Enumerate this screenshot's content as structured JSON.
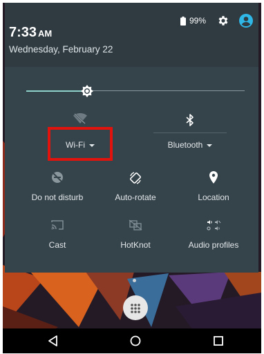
{
  "status": {
    "time": "7:33",
    "ampm": "AM",
    "date": "Wednesday, February 22",
    "battery": "99%"
  },
  "brightness": {
    "level": 0.28
  },
  "tiles": {
    "wifi": {
      "label": "Wi-Fi",
      "icon": "wifi-off-icon",
      "has_dropdown": true
    },
    "bluetooth": {
      "label": "Bluetooth",
      "icon": "bluetooth-icon",
      "has_dropdown": true
    },
    "dnd": {
      "label": "Do not disturb",
      "icon": "do-not-disturb-icon"
    },
    "autorotate": {
      "label": "Auto-rotate",
      "icon": "auto-rotate-icon"
    },
    "location": {
      "label": "Location",
      "icon": "location-pin-icon"
    },
    "cast": {
      "label": "Cast",
      "icon": "cast-icon"
    },
    "hotknot": {
      "label": "HotKnot",
      "icon": "hotknot-icon"
    },
    "audio": {
      "label": "Audio profiles",
      "icon": "audio-profiles-icon"
    }
  },
  "colors": {
    "header_bg": "#2f3b41",
    "panel_bg": "#35434a",
    "accent": "#8fd2cc",
    "avatar": "#2fb7e8",
    "highlight": "#e2130d"
  }
}
